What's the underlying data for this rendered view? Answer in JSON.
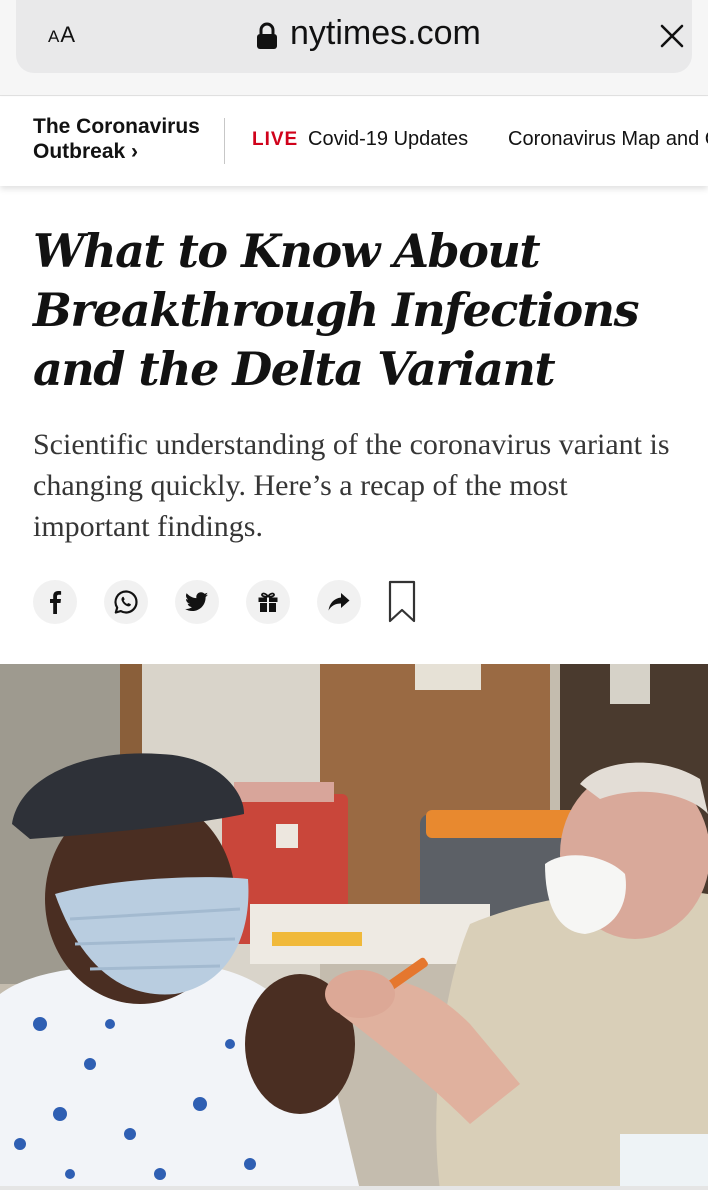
{
  "browser": {
    "text_size_label_small": "A",
    "text_size_label_large": "A",
    "url": "nytimes.com"
  },
  "section_nav": {
    "title_line1": "The Coronavirus",
    "title_line2": "Outbreak ›",
    "live_label": "LIVE",
    "link1": "Covid-19 Updates",
    "link2": "Coronavirus Map and Cases"
  },
  "article": {
    "headline": "What to Know About Breakthrough Infections and the Delta Variant",
    "summary": "Scientific understanding of the coronavirus variant is changing quickly. Here’s a recap of the most important findings."
  },
  "share_tools": [
    {
      "name": "facebook-icon"
    },
    {
      "name": "whatsapp-icon"
    },
    {
      "name": "twitter-icon"
    },
    {
      "name": "gift-icon"
    },
    {
      "name": "share-icon"
    },
    {
      "name": "bookmark-icon"
    }
  ],
  "colors": {
    "live_red": "#d0021b",
    "ink": "#121212",
    "summary_gray": "#363636"
  }
}
